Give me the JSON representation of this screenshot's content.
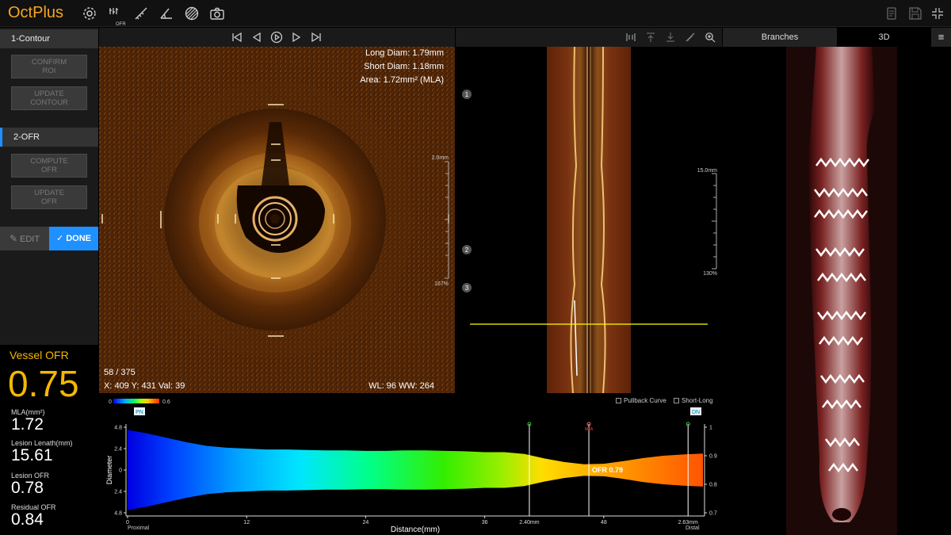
{
  "app": {
    "title": "OctPlus"
  },
  "toolbar": {
    "icons": [
      "gear-icon",
      "ofr-icon",
      "measure-icon",
      "angle-icon",
      "hatch-icon",
      "camera-icon"
    ],
    "ofr_label": "OFR"
  },
  "left": {
    "sections": [
      {
        "label": "1-Contour"
      },
      {
        "label": "2-OFR"
      }
    ],
    "buttons": {
      "confirm_roi_1": "CONFIRM",
      "confirm_roi_2": "ROI",
      "update_contour_1": "UPDATE",
      "update_contour_2": "CONTOUR",
      "compute_ofr_1": "COMPUTE",
      "compute_ofr_2": "OFR",
      "update_ofr_1": "UPDATE",
      "update_ofr_2": "OFR",
      "edit": "EDIT",
      "done": "DONE"
    },
    "metrics": {
      "vessel_label": "Vessel OFR",
      "vessel_value": "0.75",
      "mla_label": "MLA(mm²)",
      "mla_value": "1.72",
      "lesion_length_label": "Lesion Lenath(mm)",
      "lesion_length_value": "15.61",
      "lesion_ofr_label": "Lesion OFR",
      "lesion_ofr_value": "0.78",
      "residual_ofr_label": "Residual OFR",
      "residual_ofr_value": "0.84"
    }
  },
  "oct": {
    "long_diam": "Long Diam: 1.79mm",
    "short_diam": "Short Diam: 1.18mm",
    "area": "Area: 1.72mm² (MLA)",
    "frame": "58 / 375",
    "coords": "X: 409  Y: 431  Val: 39",
    "wlww": "WL: 96  WW: 264",
    "scale_top": "2.0mm",
    "scale_bottom": "167%"
  },
  "lview": {
    "scale_top": "15.0mm",
    "scale_bottom": "130%",
    "markers": [
      "1",
      "2",
      "3"
    ]
  },
  "right": {
    "tabs": [
      "Branches",
      "3D"
    ],
    "active_tab": "3D"
  },
  "chart_data": {
    "type": "area",
    "xlabel": "Distance(mm)",
    "ylabel": "Diameter",
    "x_ticks": [
      "0",
      "12",
      "24",
      "36",
      "48"
    ],
    "xlim": [
      0,
      58
    ],
    "y_ticks_left": [
      "4.8",
      "2.4",
      "0",
      "2.4",
      "4.8"
    ],
    "ylim_left": [
      -4.8,
      4.8
    ],
    "y_ticks_right": [
      "1",
      "0.9",
      "0.8",
      "0.7"
    ],
    "ylim_right": [
      0.7,
      1.0
    ],
    "colorbar": {
      "min_label": "0",
      "max_label": "0.6"
    },
    "x_label_left": "Proximal",
    "x_label_right": "Distal",
    "pn_label": "PN",
    "dn_label": "DN",
    "markers": [
      {
        "x": 40.5,
        "label": "2.40mm"
      },
      {
        "x": 46.5,
        "label": "MLA"
      },
      {
        "x": 56.5,
        "label": "2.63mm"
      }
    ],
    "ofr_annotation": "OFR 0.79",
    "diameter_profile": {
      "x": [
        0,
        2,
        4,
        6,
        8,
        10,
        12,
        14,
        16,
        18,
        20,
        22,
        24,
        26,
        28,
        30,
        32,
        34,
        36,
        38,
        40,
        42,
        44,
        46,
        48,
        50,
        52,
        54,
        56,
        58
      ],
      "y": [
        4.5,
        4.1,
        3.6,
        3.1,
        2.7,
        2.5,
        2.4,
        2.3,
        2.3,
        2.25,
        2.2,
        2.2,
        2.15,
        2.15,
        2.2,
        2.2,
        2.15,
        2.1,
        2.0,
        2.0,
        1.8,
        1.3,
        0.9,
        0.65,
        0.7,
        1.0,
        1.35,
        1.6,
        1.75,
        1.85
      ]
    },
    "options": [
      "Pullback Curve",
      "Short-Long"
    ]
  }
}
